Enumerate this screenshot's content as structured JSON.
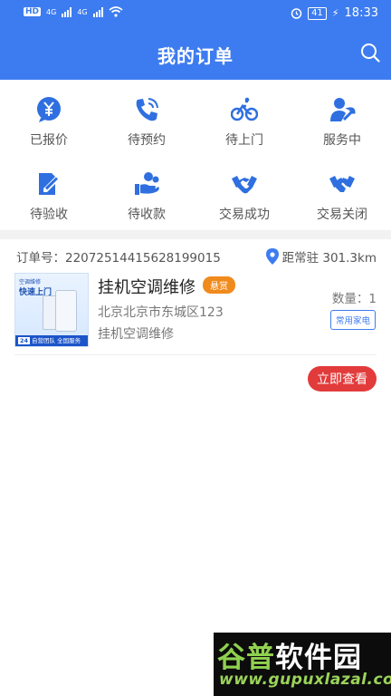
{
  "status_bar": {
    "left_badges": [
      "HD",
      "4G",
      "4G"
    ],
    "alarm_icon": "alarm-icon",
    "battery": "41",
    "time": "18:33"
  },
  "header": {
    "title": "我的订单",
    "search_icon": "search-icon",
    "background": "#3d7cf0"
  },
  "categories": [
    {
      "label": "已报价",
      "icon": "yuan-chat-icon"
    },
    {
      "label": "待预约",
      "icon": "phone-icon"
    },
    {
      "label": "待上门",
      "icon": "bicycle-icon"
    },
    {
      "label": "服务中",
      "icon": "worker-wrench-icon"
    },
    {
      "label": "待验收",
      "icon": "edit-doc-icon"
    },
    {
      "label": "待收款",
      "icon": "hand-coin-icon"
    },
    {
      "label": "交易成功",
      "icon": "handshake-icon"
    },
    {
      "label": "交易关闭",
      "icon": "handshake-closed-icon"
    }
  ],
  "order": {
    "order_number": "订单号：22072514415628199015",
    "distance": "距常驻 301.3km",
    "thumbnail": {
      "line1": "空调维修",
      "line2": "快速上门",
      "hours": "24",
      "footer": "自营团队 全国服务"
    },
    "service_title": "挂机空调维修",
    "badge": "悬赏",
    "address": "北京北京市东城区123",
    "subtitle": "挂机空调维修",
    "quantity": "数量：1",
    "tag": "常用家电",
    "view_button": "立即查看"
  },
  "watermark": {
    "brand_green": "谷普",
    "brand_white": "软件园",
    "url": "www.gupuxlazal.com"
  },
  "colors": {
    "primary": "#3d7cf0",
    "badge": "#f08a1c",
    "action": "#e23b3b"
  }
}
